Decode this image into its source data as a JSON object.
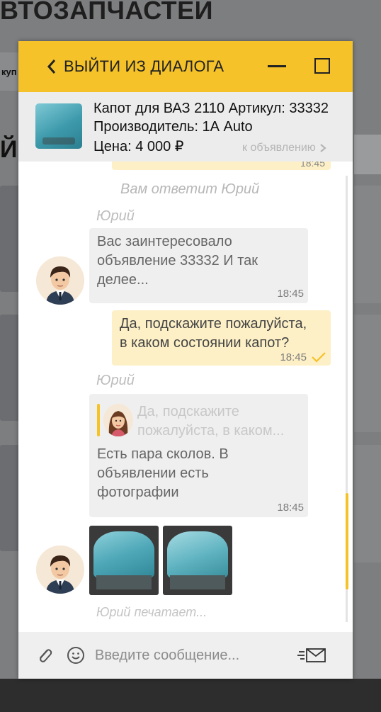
{
  "background": {
    "title": "ВТОЗАПЧАСТЕЙ",
    "tab_label": "куп",
    "letter": "Й"
  },
  "chat": {
    "header": {
      "back_label": "ВЫЙТИ ИЗ ДИАЛОГА",
      "accent_color": "#f5c22a"
    },
    "ad": {
      "title_line": "Капот для ВАЗ 2110  Артикул: 33332",
      "manufacturer_line": "Производитель: 1А Auto",
      "price_line": "Цена: 4 000 ₽",
      "link_label": "к объявлению"
    },
    "previous_time": "18:45",
    "system_note": "Вам ответит Юрий",
    "messages": [
      {
        "direction": "in",
        "sender": "Юрий",
        "lines": [
          "Вас заинтересовало",
          "объявление 33332 И так",
          "делее..."
        ],
        "time": "18:45"
      },
      {
        "direction": "out",
        "lines": [
          "Да, подскажите пожалуйста,",
          "в каком состоянии капот?"
        ],
        "time": "18:45",
        "read": true
      },
      {
        "direction": "in",
        "sender": "Юрий",
        "quote_lines": [
          "Да, подскажите",
          "пожалуйста, в каком..."
        ],
        "lines": [
          "Есть пара сколов. В",
          "объявлении есть",
          "фотографии"
        ],
        "time": "18:45"
      }
    ],
    "photos_count": 2,
    "typing": "Юрий печатает...",
    "composer": {
      "placeholder": "Введите сообщение..."
    }
  }
}
